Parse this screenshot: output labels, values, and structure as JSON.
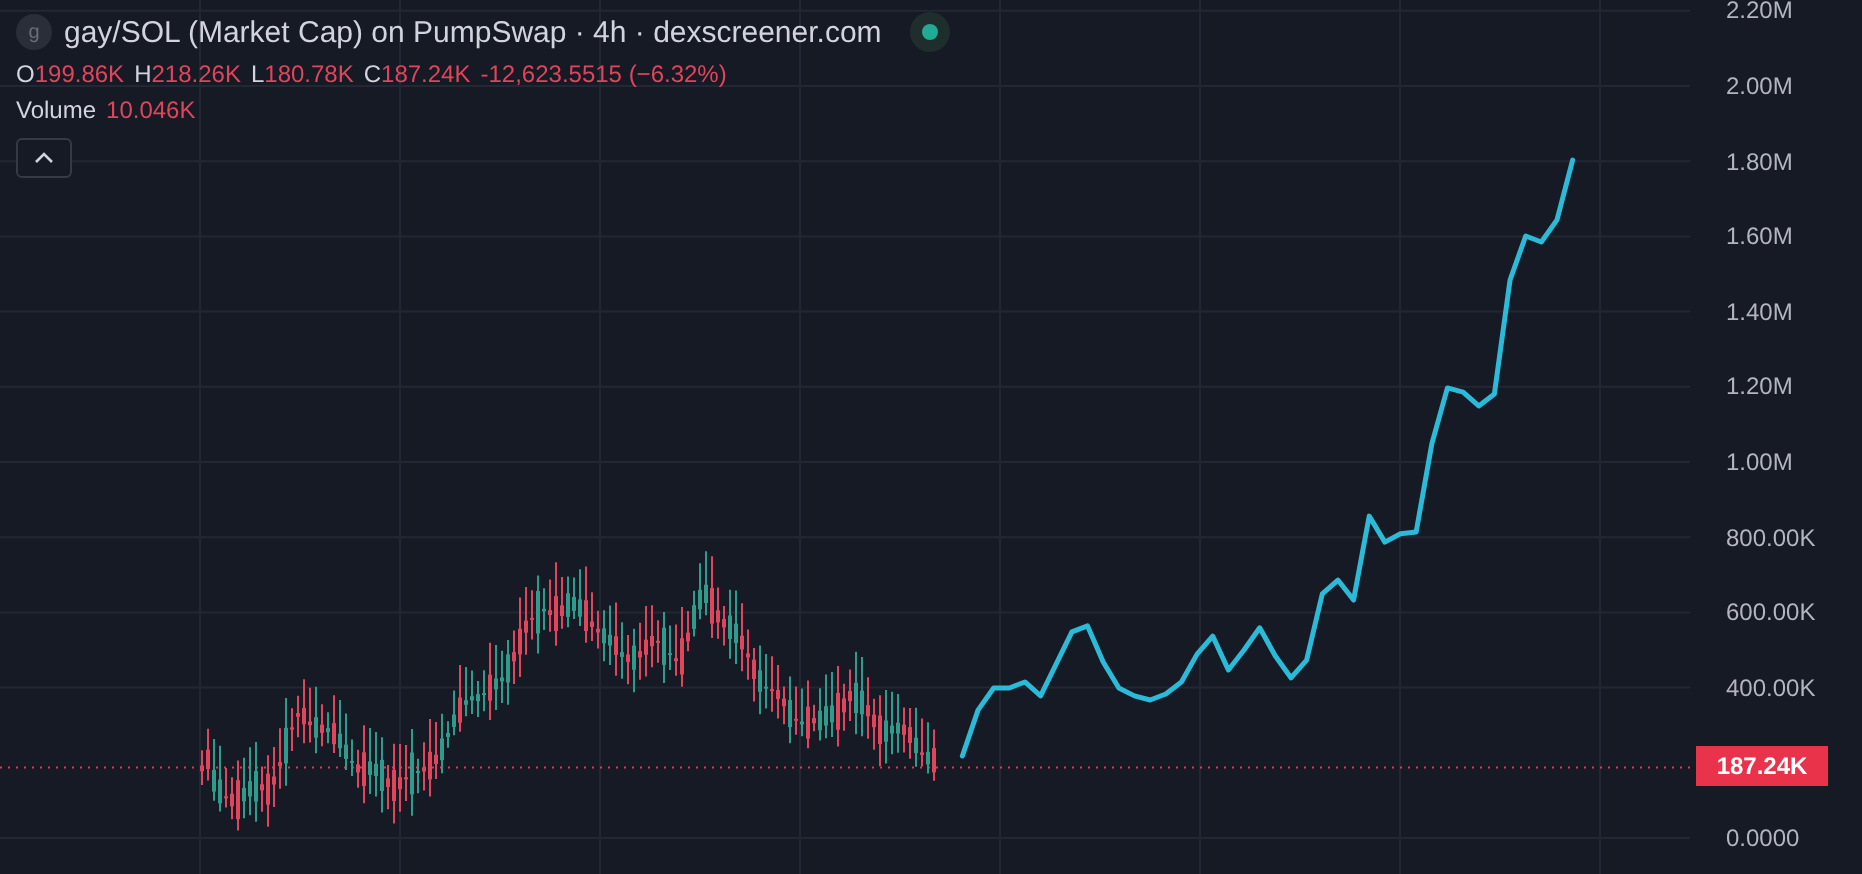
{
  "header": {
    "symbol_letter": "g",
    "title": "gay/SOL (Market Cap) on PumpSwap · 4h · dexscreener.com"
  },
  "ohlc": [
    {
      "label": "O",
      "value": "199.86K"
    },
    {
      "label": "H",
      "value": "218.26K"
    },
    {
      "label": "L",
      "value": "180.78K"
    },
    {
      "label": "C",
      "value": "187.24K"
    }
  ],
  "change": "-12,623.5515 (−6.32%)",
  "volume": {
    "label": "Volume",
    "value": "10.046K"
  },
  "chart": {
    "current_price": "187.24K",
    "chart_data": {
      "type": "line",
      "grid": true,
      "ylim": [
        0,
        2200000
      ],
      "ref_lines": [
        {
          "axis": "y",
          "value": 187240,
          "color": "#e9334b"
        }
      ],
      "categories": [
        null,
        null,
        null,
        null,
        null,
        null,
        null,
        null,
        null,
        null,
        null,
        null,
        null,
        null,
        null,
        null,
        null,
        null,
        null,
        null,
        null,
        null,
        null,
        null,
        null,
        null,
        null,
        null,
        null,
        null,
        null,
        null,
        null,
        null,
        null,
        null,
        null,
        null,
        null,
        null,
        null,
        null,
        null,
        null,
        null,
        null,
        null,
        null,
        null,
        null,
        null,
        null,
        null,
        null,
        null,
        null,
        null,
        null,
        null,
        null,
        null,
        null,
        null,
        null,
        null,
        null,
        null,
        null,
        null,
        null,
        null,
        null,
        null,
        null,
        null,
        null,
        null,
        null,
        null,
        null,
        null,
        null,
        null,
        null,
        null,
        null,
        null,
        null,
        null,
        null,
        null,
        null,
        null,
        null,
        null,
        null,
        null,
        null,
        null,
        null,
        null,
        null,
        null,
        null,
        null,
        null,
        null,
        null
      ],
      "yticks": [
        {
          "value": 2200000,
          "label": "2.20M"
        },
        {
          "value": 2000000,
          "label": "2.00M"
        },
        {
          "value": 1800000,
          "label": "1.80M"
        },
        {
          "value": 1600000,
          "label": "1.60M"
        },
        {
          "value": 1400000,
          "label": "1.40M"
        },
        {
          "value": 1200000,
          "label": "1.20M"
        },
        {
          "value": 1000000,
          "label": "1.00M"
        },
        {
          "value": 800000,
          "label": "800.00K"
        },
        {
          "value": 600000,
          "label": "600.00K"
        },
        {
          "value": 400000,
          "label": "400.00K"
        },
        {
          "value": 0,
          "label": "0.0000"
        }
      ],
      "series": [
        {
          "color": "#2bbbd8",
          "values": [
            null,
            null,
            null,
            null,
            null,
            null,
            null,
            null,
            null,
            null,
            null,
            null,
            null,
            null,
            null,
            null,
            null,
            null,
            null,
            null,
            null,
            null,
            null,
            null,
            null,
            null,
            null,
            null,
            null,
            null,
            null,
            null,
            null,
            null,
            null,
            null,
            null,
            null,
            null,
            null,
            null,
            null,
            null,
            null,
            null,
            null,
            null,
            null,
            null,
            null,
            null,
            null,
            null,
            null,
            null,
            null,
            null,
            null,
            null,
            null,
            null,
            218000,
            340000,
            399000,
            399000,
            415000,
            378000,
            463000,
            548000,
            564000,
            468000,
            399000,
            378000,
            367000,
            383000,
            415000,
            489000,
            537000,
            447000,
            500000,
            559000,
            484000,
            426000,
            473000,
            649000,
            686000,
            633000,
            856000,
            787000,
            809000,
            814000,
            1048000,
            1197000,
            1186000,
            1149000,
            1181000,
            1484000,
            1601000,
            1585000,
            1644000,
            1803000,
            null,
            null,
            null,
            null,
            null,
            null,
            null
          ]
        }
      ]
    }
  }
}
